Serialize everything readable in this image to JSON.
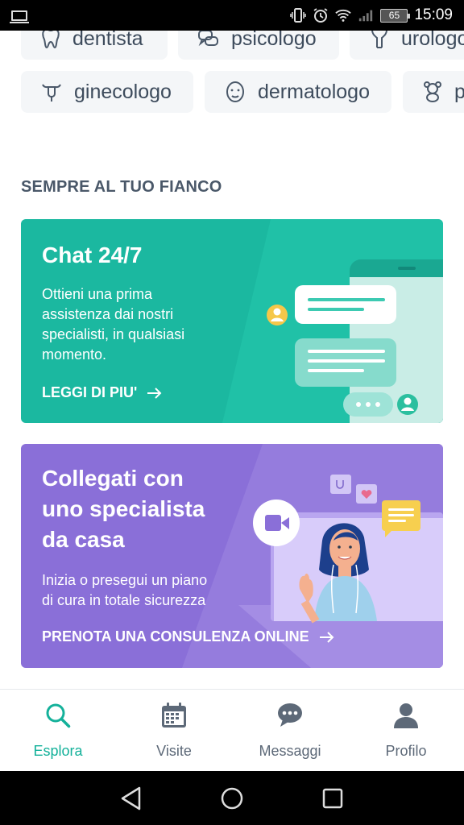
{
  "status_bar": {
    "time": "15:09",
    "battery_level": "65",
    "icons": [
      "laptop-icon",
      "vibrate-icon",
      "alarm-icon",
      "wifi-icon",
      "signal-icon",
      "battery-icon"
    ]
  },
  "specialties": {
    "row1": [
      {
        "label": "dentista",
        "icon": "tooth-icon"
      },
      {
        "label": "psicologo",
        "icon": "speech-bubbles-icon"
      },
      {
        "label": "urologo",
        "icon": "urology-icon"
      }
    ],
    "row2": [
      {
        "label": "ginecologo",
        "icon": "uterus-icon"
      },
      {
        "label": "dermatologo",
        "icon": "face-icon"
      },
      {
        "label": "p",
        "icon": "teddy-bear-icon"
      }
    ]
  },
  "section_title": "SEMPRE AL TUO FIANCO",
  "cards": {
    "chat": {
      "title": "Chat 24/7",
      "desc_lines": [
        "Ottieni una prima",
        "assistenza dai nostri",
        "specialisti, in qualsiasi",
        "momento."
      ],
      "link": "LEGGI DI PIU'",
      "color": "#1bb8a0"
    },
    "video": {
      "title_lines": [
        "Collegati con",
        "uno specialista",
        "da casa"
      ],
      "desc_lines": [
        "Inizia o presegui un piano",
        "di cura in totale sicurezza"
      ],
      "link": "PRENOTA UNA CONSULENZA ONLINE",
      "color": "#8a6fd8"
    }
  },
  "bottom_nav": {
    "active_color": "#14b19a",
    "items": [
      {
        "label": "Esplora",
        "icon": "search-icon",
        "active": true
      },
      {
        "label": "Visite",
        "icon": "calendar-icon",
        "active": false
      },
      {
        "label": "Messaggi",
        "icon": "chat-icon",
        "active": false
      },
      {
        "label": "Profilo",
        "icon": "user-icon",
        "active": false
      }
    ]
  },
  "system_nav": [
    "back-icon",
    "home-icon",
    "recents-icon"
  ]
}
